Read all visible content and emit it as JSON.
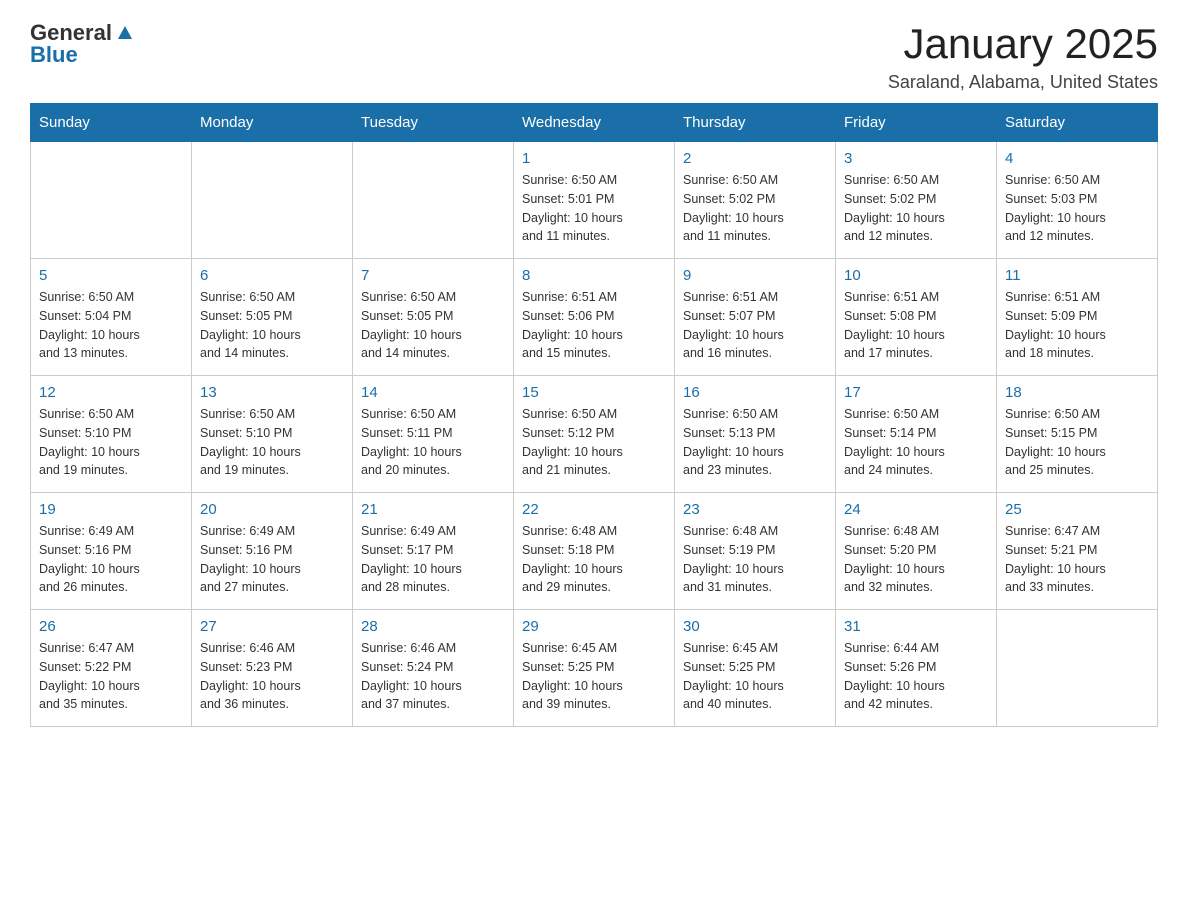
{
  "logo": {
    "general": "General",
    "blue": "Blue"
  },
  "header": {
    "title": "January 2025",
    "location": "Saraland, Alabama, United States"
  },
  "weekdays": [
    "Sunday",
    "Monday",
    "Tuesday",
    "Wednesday",
    "Thursday",
    "Friday",
    "Saturday"
  ],
  "weeks": [
    [
      {
        "day": "",
        "info": ""
      },
      {
        "day": "",
        "info": ""
      },
      {
        "day": "",
        "info": ""
      },
      {
        "day": "1",
        "info": "Sunrise: 6:50 AM\nSunset: 5:01 PM\nDaylight: 10 hours\nand 11 minutes."
      },
      {
        "day": "2",
        "info": "Sunrise: 6:50 AM\nSunset: 5:02 PM\nDaylight: 10 hours\nand 11 minutes."
      },
      {
        "day": "3",
        "info": "Sunrise: 6:50 AM\nSunset: 5:02 PM\nDaylight: 10 hours\nand 12 minutes."
      },
      {
        "day": "4",
        "info": "Sunrise: 6:50 AM\nSunset: 5:03 PM\nDaylight: 10 hours\nand 12 minutes."
      }
    ],
    [
      {
        "day": "5",
        "info": "Sunrise: 6:50 AM\nSunset: 5:04 PM\nDaylight: 10 hours\nand 13 minutes."
      },
      {
        "day": "6",
        "info": "Sunrise: 6:50 AM\nSunset: 5:05 PM\nDaylight: 10 hours\nand 14 minutes."
      },
      {
        "day": "7",
        "info": "Sunrise: 6:50 AM\nSunset: 5:05 PM\nDaylight: 10 hours\nand 14 minutes."
      },
      {
        "day": "8",
        "info": "Sunrise: 6:51 AM\nSunset: 5:06 PM\nDaylight: 10 hours\nand 15 minutes."
      },
      {
        "day": "9",
        "info": "Sunrise: 6:51 AM\nSunset: 5:07 PM\nDaylight: 10 hours\nand 16 minutes."
      },
      {
        "day": "10",
        "info": "Sunrise: 6:51 AM\nSunset: 5:08 PM\nDaylight: 10 hours\nand 17 minutes."
      },
      {
        "day": "11",
        "info": "Sunrise: 6:51 AM\nSunset: 5:09 PM\nDaylight: 10 hours\nand 18 minutes."
      }
    ],
    [
      {
        "day": "12",
        "info": "Sunrise: 6:50 AM\nSunset: 5:10 PM\nDaylight: 10 hours\nand 19 minutes."
      },
      {
        "day": "13",
        "info": "Sunrise: 6:50 AM\nSunset: 5:10 PM\nDaylight: 10 hours\nand 19 minutes."
      },
      {
        "day": "14",
        "info": "Sunrise: 6:50 AM\nSunset: 5:11 PM\nDaylight: 10 hours\nand 20 minutes."
      },
      {
        "day": "15",
        "info": "Sunrise: 6:50 AM\nSunset: 5:12 PM\nDaylight: 10 hours\nand 21 minutes."
      },
      {
        "day": "16",
        "info": "Sunrise: 6:50 AM\nSunset: 5:13 PM\nDaylight: 10 hours\nand 23 minutes."
      },
      {
        "day": "17",
        "info": "Sunrise: 6:50 AM\nSunset: 5:14 PM\nDaylight: 10 hours\nand 24 minutes."
      },
      {
        "day": "18",
        "info": "Sunrise: 6:50 AM\nSunset: 5:15 PM\nDaylight: 10 hours\nand 25 minutes."
      }
    ],
    [
      {
        "day": "19",
        "info": "Sunrise: 6:49 AM\nSunset: 5:16 PM\nDaylight: 10 hours\nand 26 minutes."
      },
      {
        "day": "20",
        "info": "Sunrise: 6:49 AM\nSunset: 5:16 PM\nDaylight: 10 hours\nand 27 minutes."
      },
      {
        "day": "21",
        "info": "Sunrise: 6:49 AM\nSunset: 5:17 PM\nDaylight: 10 hours\nand 28 minutes."
      },
      {
        "day": "22",
        "info": "Sunrise: 6:48 AM\nSunset: 5:18 PM\nDaylight: 10 hours\nand 29 minutes."
      },
      {
        "day": "23",
        "info": "Sunrise: 6:48 AM\nSunset: 5:19 PM\nDaylight: 10 hours\nand 31 minutes."
      },
      {
        "day": "24",
        "info": "Sunrise: 6:48 AM\nSunset: 5:20 PM\nDaylight: 10 hours\nand 32 minutes."
      },
      {
        "day": "25",
        "info": "Sunrise: 6:47 AM\nSunset: 5:21 PM\nDaylight: 10 hours\nand 33 minutes."
      }
    ],
    [
      {
        "day": "26",
        "info": "Sunrise: 6:47 AM\nSunset: 5:22 PM\nDaylight: 10 hours\nand 35 minutes."
      },
      {
        "day": "27",
        "info": "Sunrise: 6:46 AM\nSunset: 5:23 PM\nDaylight: 10 hours\nand 36 minutes."
      },
      {
        "day": "28",
        "info": "Sunrise: 6:46 AM\nSunset: 5:24 PM\nDaylight: 10 hours\nand 37 minutes."
      },
      {
        "day": "29",
        "info": "Sunrise: 6:45 AM\nSunset: 5:25 PM\nDaylight: 10 hours\nand 39 minutes."
      },
      {
        "day": "30",
        "info": "Sunrise: 6:45 AM\nSunset: 5:25 PM\nDaylight: 10 hours\nand 40 minutes."
      },
      {
        "day": "31",
        "info": "Sunrise: 6:44 AM\nSunset: 5:26 PM\nDaylight: 10 hours\nand 42 minutes."
      },
      {
        "day": "",
        "info": ""
      }
    ]
  ]
}
